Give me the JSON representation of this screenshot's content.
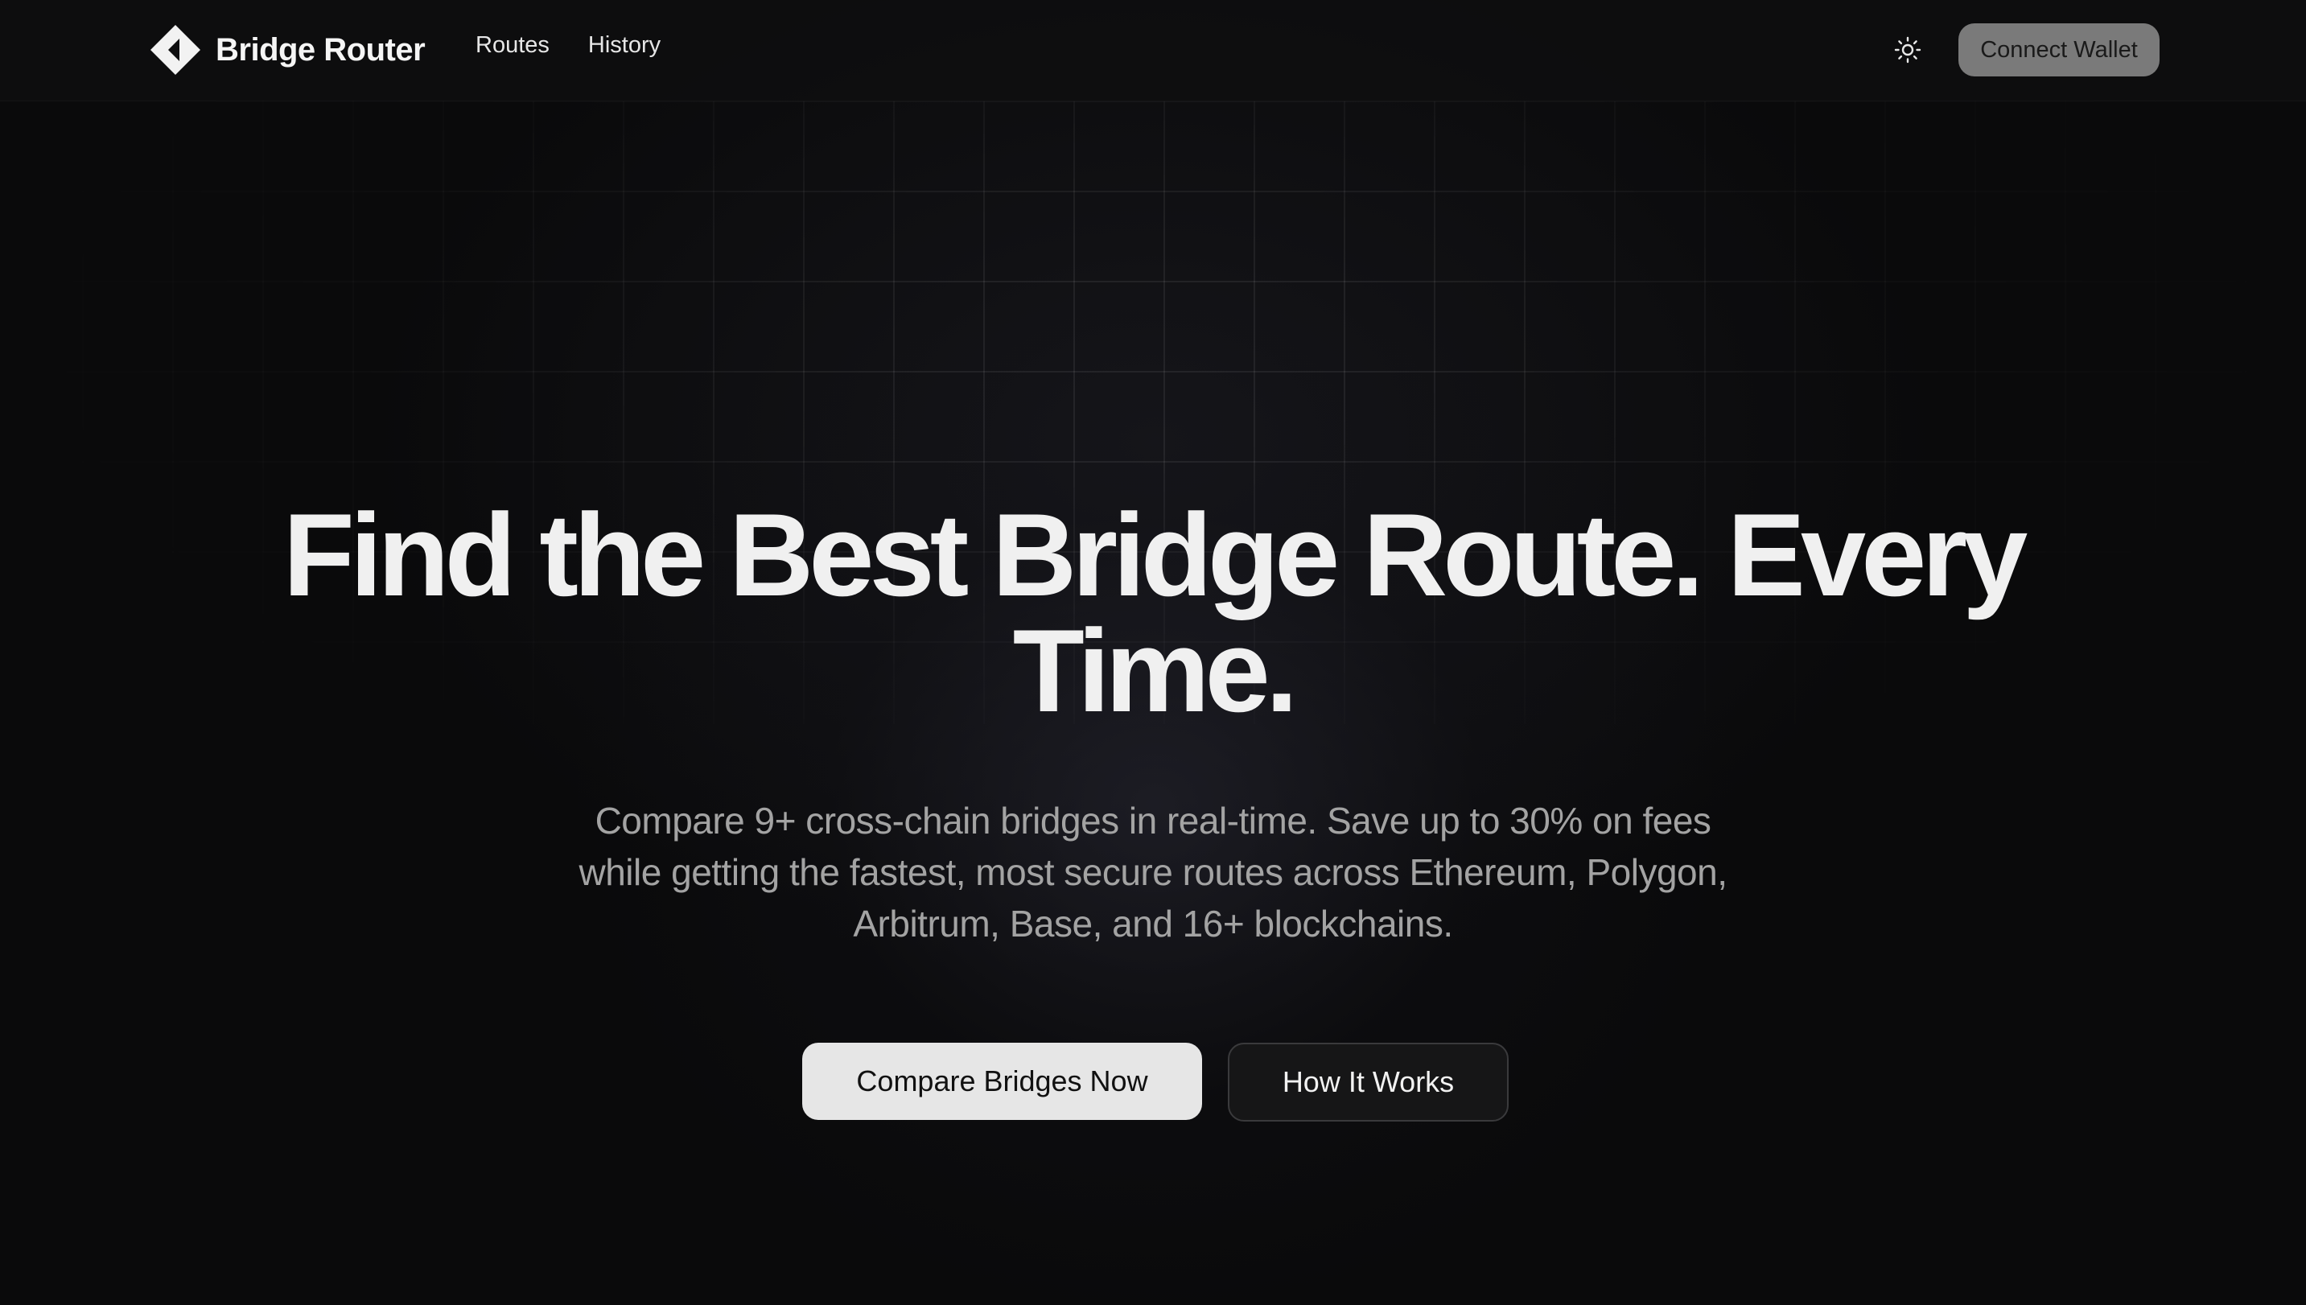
{
  "header": {
    "brand_name": "Bridge Router",
    "nav": [
      {
        "label": "Routes"
      },
      {
        "label": "History"
      }
    ],
    "theme_toggle_icon": "sun-icon",
    "connect_wallet_label": "Connect Wallet"
  },
  "hero": {
    "title_line1": "Find the Best Bridge Route. Every",
    "title_line2": "Time.",
    "subtitle": "Compare 9+ cross-chain bridges in real-time. Save up to 30% on fees while getting the fastest, most secure routes across Ethereum, Polygon, Arbitrum, Base, and 16+ blockchains.",
    "primary_cta_label": "Compare Bridges Now",
    "secondary_cta_label": "How It Works"
  },
  "colors": {
    "background": "#0a0a0b",
    "title": "#f0f0f0",
    "subtitle": "#a3a3a3",
    "primary_button": "#e6e6e6",
    "connect_button": "#7a7a7a"
  }
}
